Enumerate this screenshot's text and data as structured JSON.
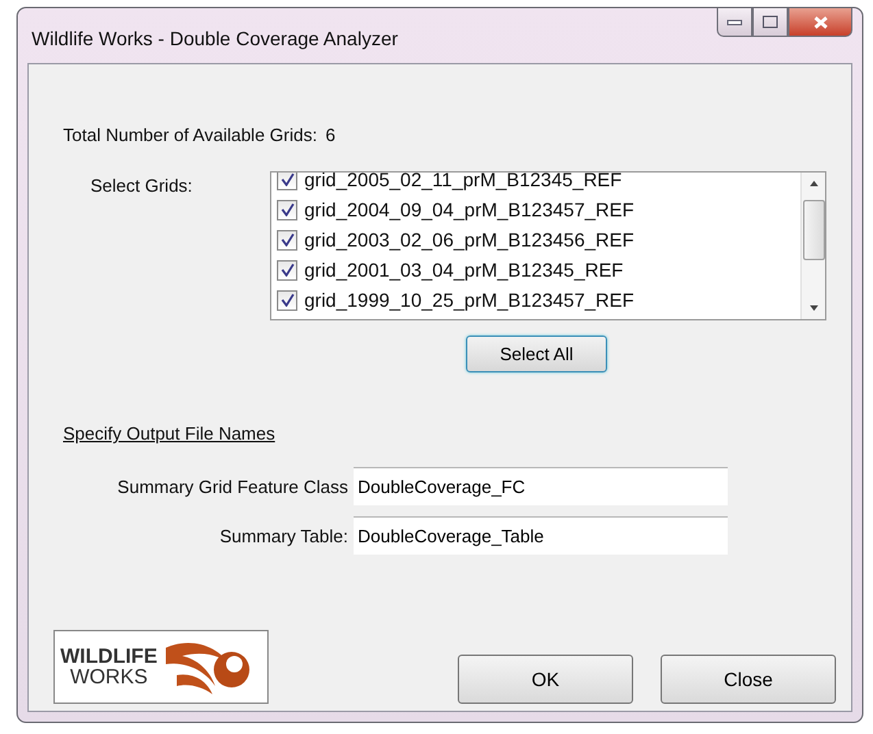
{
  "window": {
    "title": "Wildlife Works - Double Coverage Analyzer"
  },
  "total_grids": {
    "label": "Total Number of Available Grids:",
    "value": "6"
  },
  "grid_list": {
    "label": "Select Grids:",
    "items": [
      {
        "name": "grid_2005_02_11_prM_B12345_REF",
        "checked": true
      },
      {
        "name": "grid_2004_09_04_prM_B123457_REF",
        "checked": true
      },
      {
        "name": "grid_2003_02_06_prM_B123456_REF",
        "checked": true
      },
      {
        "name": "grid_2001_03_04_prM_B12345_REF",
        "checked": true
      },
      {
        "name": "grid_1999_10_25_prM_B123457_REF",
        "checked": true
      }
    ]
  },
  "select_all_button": "Select All",
  "output_section": {
    "heading": "Specify Output File Names",
    "fields": [
      {
        "label": "Summary Grid Feature Class",
        "value": "DoubleCoverage_FC"
      },
      {
        "label": "Summary Table:",
        "value": "DoubleCoverage_Table"
      }
    ]
  },
  "logo": {
    "lines": [
      "WILDLIFE",
      "WORKS"
    ]
  },
  "buttons": [
    "OK",
    "Close"
  ]
}
